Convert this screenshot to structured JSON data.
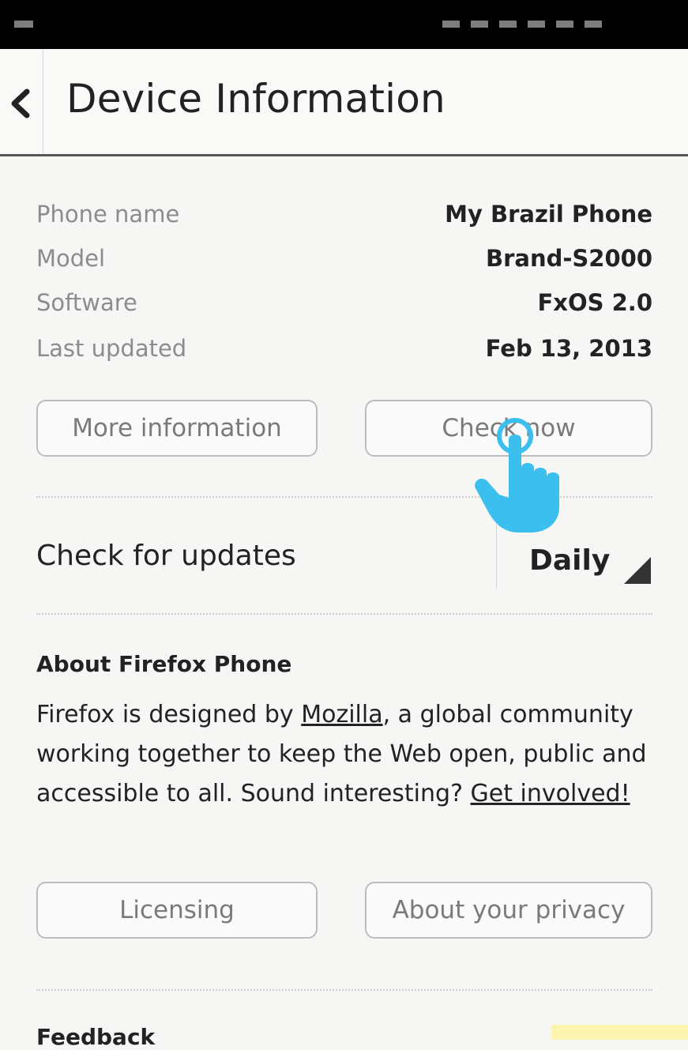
{
  "header": {
    "title": "Device Information"
  },
  "info": [
    {
      "label": "Phone name",
      "value": "My Brazil Phone"
    },
    {
      "label": "Model",
      "value": "Brand-S2000"
    },
    {
      "label": "Software",
      "value": "FxOS 2.0"
    },
    {
      "label": "Last updated",
      "value": "Feb 13, 2013"
    }
  ],
  "buttons": {
    "more_info": "More information",
    "check_now": "Check now",
    "licensing": "Licensing",
    "privacy": "About your privacy"
  },
  "updates": {
    "label": "Check for updates",
    "value": "Daily"
  },
  "about": {
    "title": "About Firefox Phone",
    "text_1": "Firefox is designed by ",
    "link_mozilla": "Mozilla",
    "text_2": ", a global community working together to keep the Web open, public and accessible to all. Sound interesting? ",
    "link_involved": "Get involved!"
  },
  "feedback": {
    "title": "Feedback"
  },
  "colors": {
    "tap_indicator": "#3bbfee",
    "background": "#f6f6f5"
  },
  "icons": {
    "back": "chevron-left-icon",
    "tap": "pointing-hand-icon",
    "dropdown": "triangle-corner-icon"
  }
}
